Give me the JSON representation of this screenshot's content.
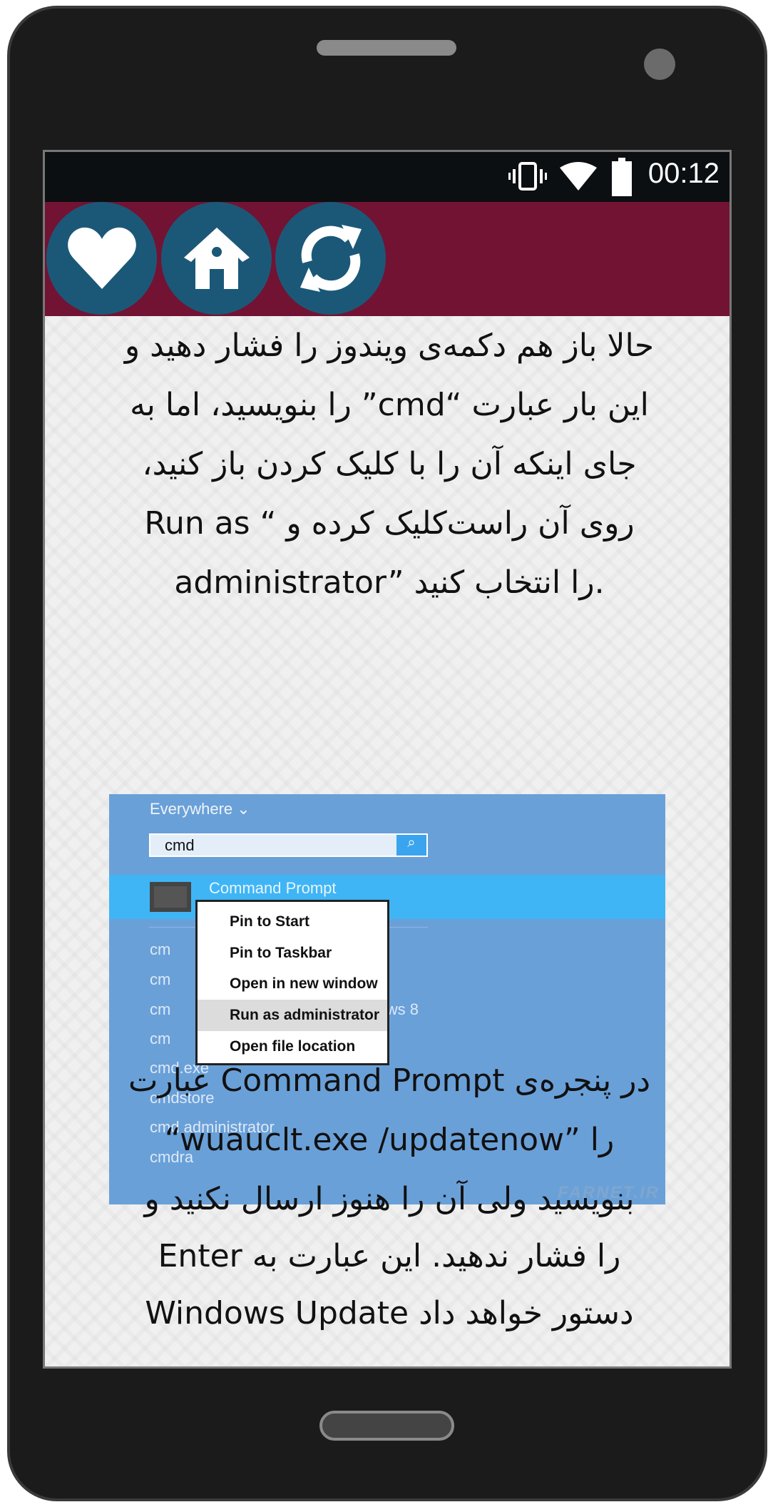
{
  "status_bar": {
    "time": "00:12",
    "icons": [
      "vibrate-icon",
      "wifi-icon",
      "battery-icon"
    ]
  },
  "toolbar": {
    "buttons": [
      {
        "icon": "heart-icon"
      },
      {
        "icon": "home-icon"
      },
      {
        "icon": "refresh-icon"
      }
    ],
    "color": "#721333",
    "button_color": "#1b5878"
  },
  "paragraph1": [
    "حالا باز هم دکمه‌ی ویندوز را فشار دهید و",
    "این بار عبارت “cmd” را بنویسید، اما به",
    "جای اینکه آن را با کلیک کردن باز کنید،",
    "روی آن راست‌کلیک کرده و “ Run as",
    "administrator” را انتخاب کنید."
  ],
  "screenshot": {
    "scope": "Everywhere",
    "search_value": "cmd",
    "top_result": "Command Prompt",
    "menu": [
      "Pin to Start",
      "Pin to Taskbar",
      "Open in new window",
      "Run as administrator",
      "Open file location"
    ],
    "highlighted": "Run as administrator",
    "results": [
      "cm",
      "cm",
      "cm",
      "cm",
      "cmd.exe",
      "cmdstore",
      "cmd administrator",
      "cmdra"
    ],
    "partial_result": "ndows 8",
    "watermark": "FARNET.IR"
  },
  "paragraph2": [
    "در پنجره‌ی Command Prompt عبارت",
    "“wuauclt.exe /updatenow” را",
    "بنویسید ولی آن را هنوز ارسال نکنید و",
    "Enter را فشار ندهید. این عبارت به",
    "Windows Update دستور خواهد داد"
  ]
}
